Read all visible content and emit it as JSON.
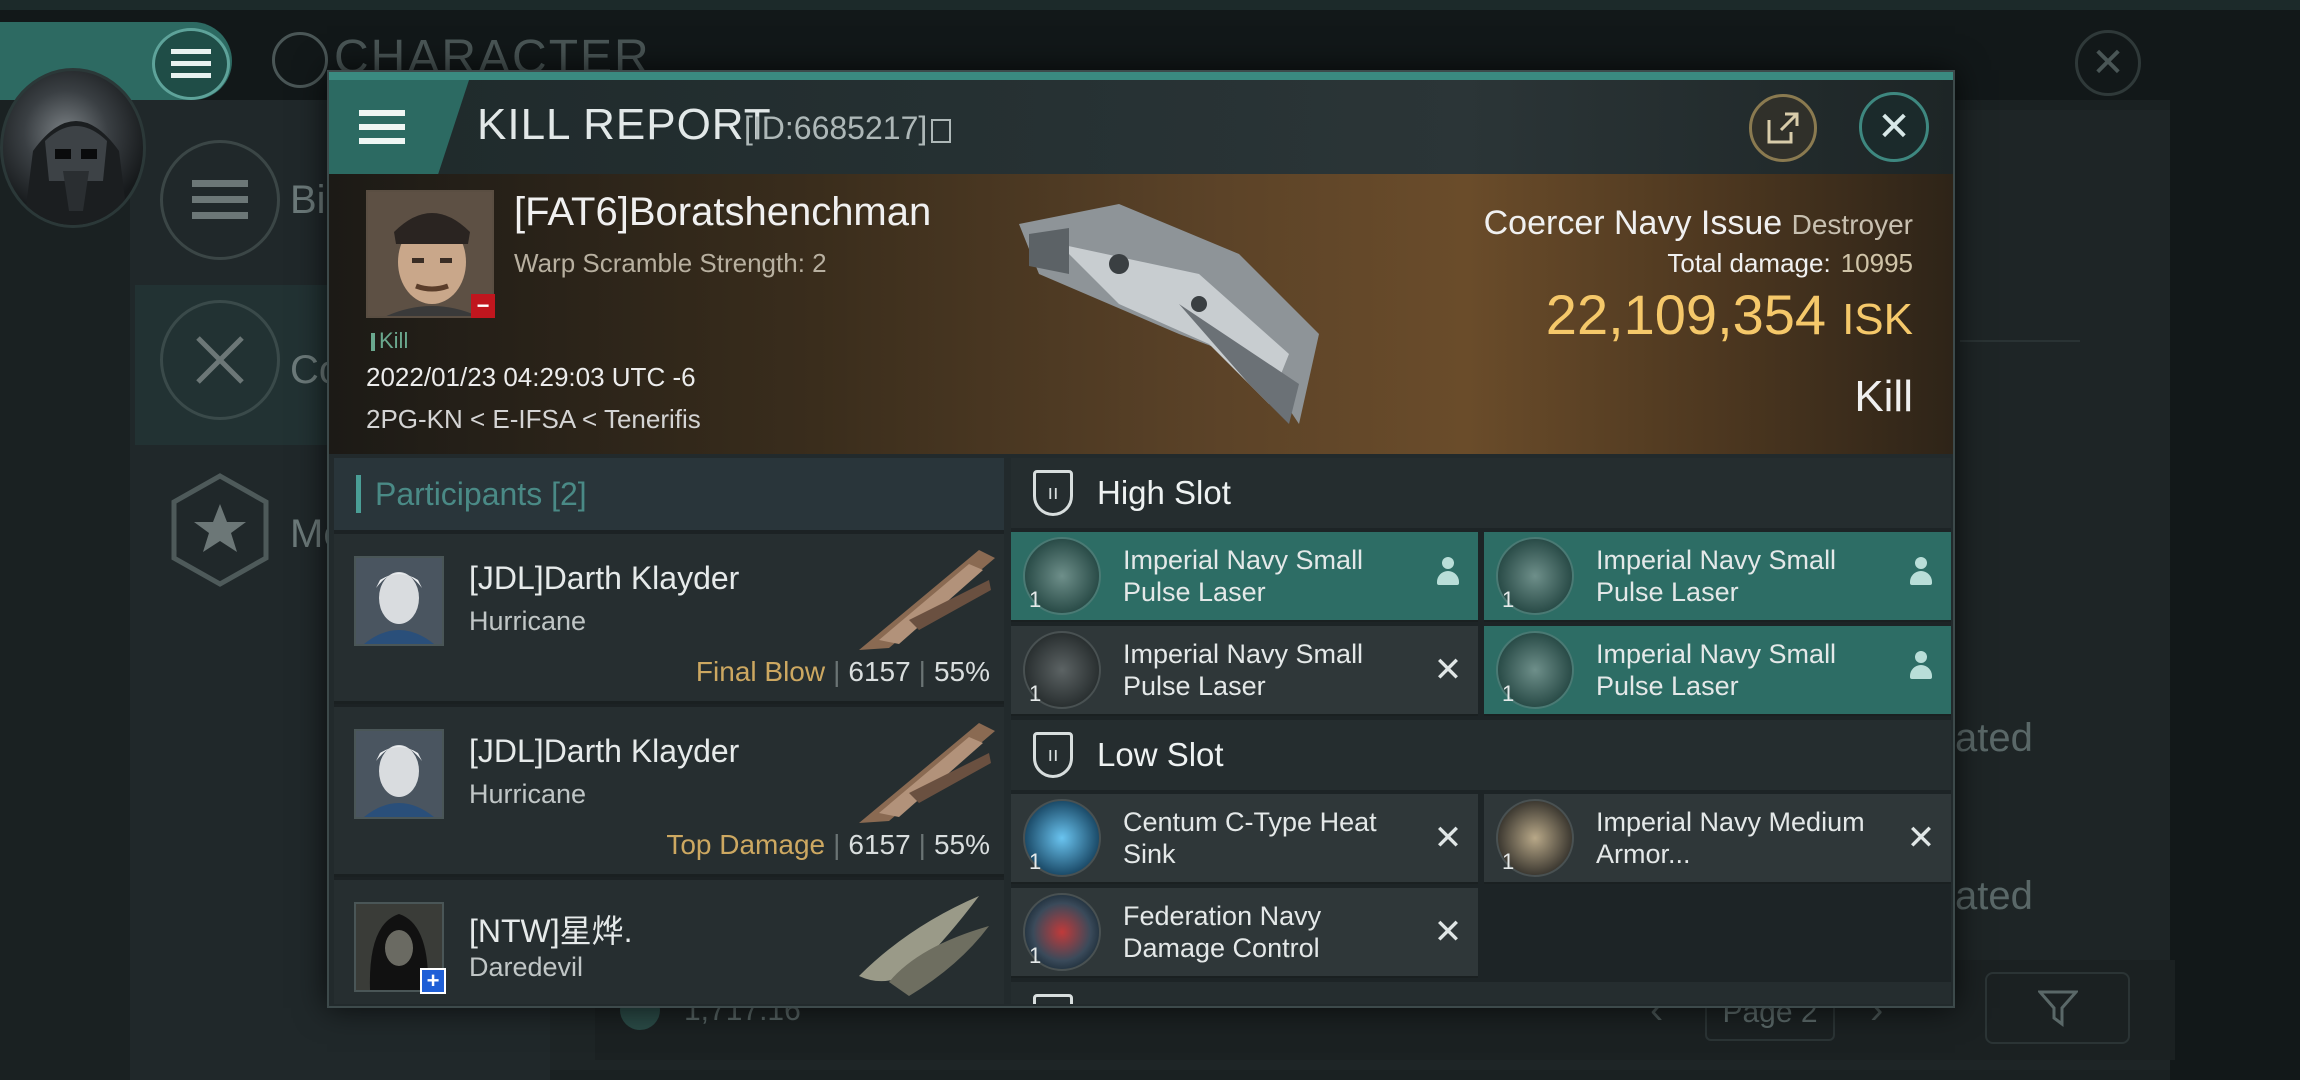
{
  "background": {
    "title": "CHARACTER",
    "sidebar": [
      {
        "label": "Bio",
        "visible_text": "Bi"
      },
      {
        "label": "Combat",
        "visible_text": "Co"
      },
      {
        "label": "Medals",
        "visible_text": "Me"
      }
    ],
    "ghost_texts": [
      "ated",
      "ated"
    ],
    "bottom_value": "1,717.16",
    "page_label": "Page 2"
  },
  "dialog": {
    "title": "KILL REPORT",
    "id_text": "[ID:6685217]"
  },
  "victim": {
    "name": "[FAT6]Boratshenchman",
    "warp": "Warp Scramble Strength: 2",
    "kill_tag": "Kill",
    "datetime": "2022/01/23 04:29:03 UTC -6",
    "location": "2PG-KN < E-IFSA < Tenerifis",
    "ship_name": "Coercer Navy Issue",
    "ship_class": "Destroyer",
    "total_damage_label": "Total damage:",
    "total_damage": "10995",
    "isk_value": "22,109,354",
    "isk_unit": "ISK",
    "report_type": "Kill"
  },
  "participants": {
    "label": "Participants",
    "count": "[2]",
    "rows": [
      {
        "name": "[JDL]Darth Klayder",
        "ship": "Hurricane",
        "role": "Final Blow",
        "damage": "6157",
        "percent": "55%"
      },
      {
        "name": "[JDL]Darth Klayder",
        "ship": "Hurricane",
        "role": "Top Damage",
        "damage": "6157",
        "percent": "55%"
      },
      {
        "name": "[NTW]星烨.",
        "ship": "Daredevil",
        "role": "",
        "damage": "",
        "percent": ""
      }
    ]
  },
  "slots": {
    "high": {
      "label": "High Slot",
      "modules": [
        {
          "name": "Imperial Navy Small Pulse Laser",
          "qty": "1",
          "status": "dropped"
        },
        {
          "name": "Imperial Navy Small Pulse Laser",
          "qty": "1",
          "status": "dropped"
        },
        {
          "name": "Imperial Navy Small Pulse Laser",
          "qty": "1",
          "status": "destroyed"
        },
        {
          "name": "Imperial Navy Small Pulse Laser",
          "qty": "1",
          "status": "dropped"
        }
      ]
    },
    "low": {
      "label": "Low Slot",
      "modules": [
        {
          "name": "Centum C-Type Heat Sink",
          "qty": "1",
          "status": "destroyed"
        },
        {
          "name": "Imperial Navy Medium Armor...",
          "qty": "1",
          "status": "destroyed"
        },
        {
          "name": "Federation Navy Damage Control",
          "qty": "1",
          "status": "destroyed"
        }
      ]
    }
  },
  "colors": {
    "accent": "#2d6d65",
    "isk": "#f5c86a",
    "role": "#cda861",
    "victim_badge": "#c0161e"
  }
}
